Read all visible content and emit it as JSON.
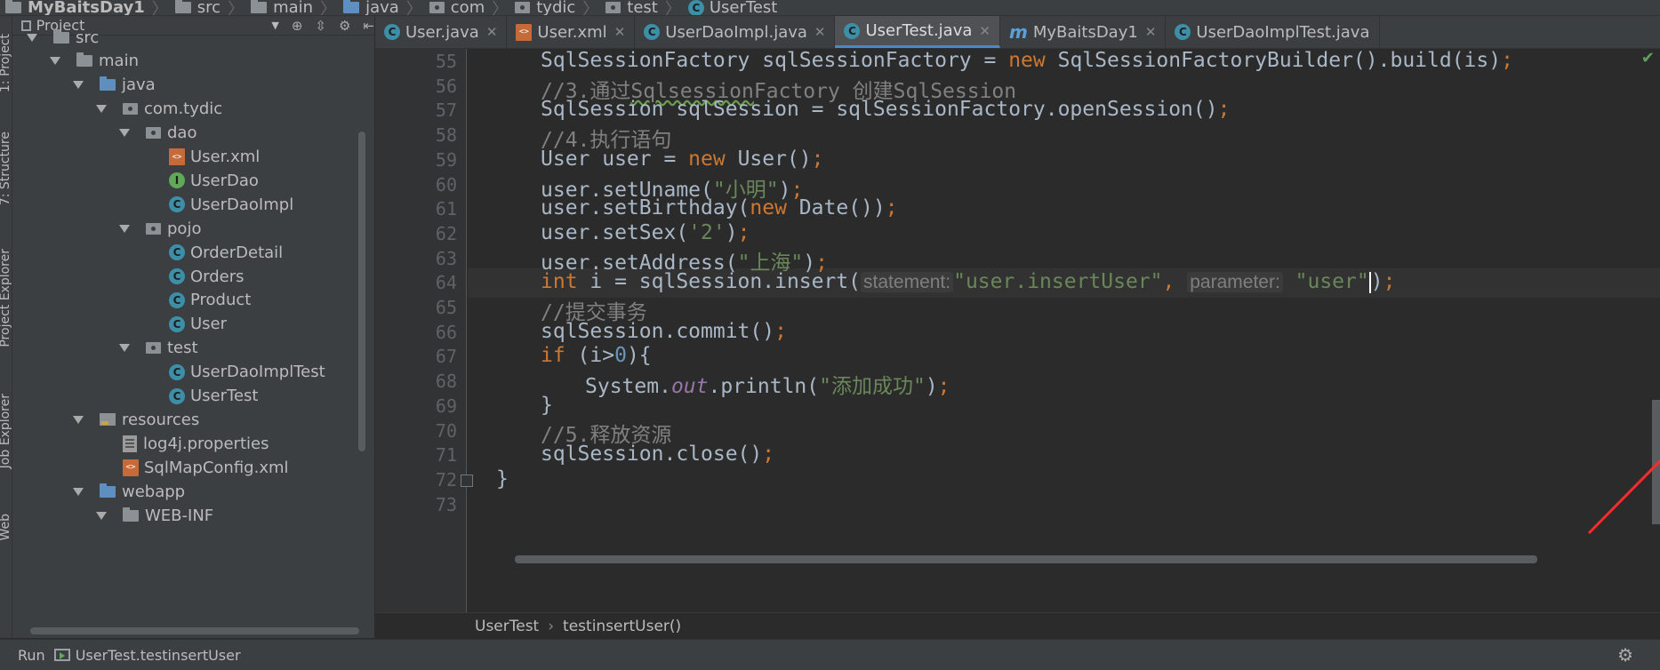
{
  "breadcrumb": {
    "items": [
      "MyBaitsDay1",
      "src",
      "main",
      "java",
      "com",
      "tydic",
      "test",
      "UserTest"
    ]
  },
  "side_tabs": {
    "project": "1: Project",
    "structure": "7: Structure",
    "project_explorer": "Project Explorer",
    "job_explorer": "Job Explorer",
    "web": "Web"
  },
  "project_panel": {
    "title": "Project",
    "tree": [
      {
        "label": "src",
        "type": "folder",
        "depth": 0,
        "expanded": true
      },
      {
        "label": "main",
        "type": "folder",
        "depth": 1,
        "expanded": true
      },
      {
        "label": "java",
        "type": "folder-blue",
        "depth": 2,
        "expanded": true
      },
      {
        "label": "com.tydic",
        "type": "package",
        "depth": 3,
        "expanded": true
      },
      {
        "label": "dao",
        "type": "package",
        "depth": 4,
        "expanded": true
      },
      {
        "label": "User.xml",
        "type": "xml",
        "depth": 5
      },
      {
        "label": "UserDao",
        "type": "interface",
        "depth": 5
      },
      {
        "label": "UserDaoImpl",
        "type": "class",
        "depth": 5
      },
      {
        "label": "pojo",
        "type": "package",
        "depth": 4,
        "expanded": true
      },
      {
        "label": "OrderDetail",
        "type": "class",
        "depth": 5
      },
      {
        "label": "Orders",
        "type": "class",
        "depth": 5
      },
      {
        "label": "Product",
        "type": "class",
        "depth": 5
      },
      {
        "label": "User",
        "type": "class",
        "depth": 5
      },
      {
        "label": "test",
        "type": "package",
        "depth": 4,
        "expanded": true
      },
      {
        "label": "UserDaoImplTest",
        "type": "class",
        "depth": 5
      },
      {
        "label": "UserTest",
        "type": "class",
        "depth": 5
      },
      {
        "label": "resources",
        "type": "resources",
        "depth": 2,
        "expanded": true
      },
      {
        "label": "log4j.properties",
        "type": "properties",
        "depth": 3
      },
      {
        "label": "SqlMapConfig.xml",
        "type": "xml",
        "depth": 3
      },
      {
        "label": "webapp",
        "type": "folder-blue",
        "depth": 2,
        "expanded": true
      },
      {
        "label": "WEB-INF",
        "type": "folder",
        "depth": 3,
        "expanded": true
      }
    ]
  },
  "tabs": [
    {
      "label": "User.java",
      "icon": "class-icon",
      "active": false
    },
    {
      "label": "User.xml",
      "icon": "xml-file-icon",
      "active": false
    },
    {
      "label": "UserDaoImpl.java",
      "icon": "class-icon",
      "active": false
    },
    {
      "label": "UserTest.java",
      "icon": "class-icon",
      "active": true
    },
    {
      "label": "MyBaitsDay1",
      "icon": "maven-icon",
      "active": false
    },
    {
      "label": "UserDaoImplTest.java",
      "icon": "class-icon",
      "active": false
    }
  ],
  "editor": {
    "line_numbers": [
      "55",
      "56",
      "57",
      "58",
      "59",
      "60",
      "61",
      "62",
      "63",
      "64",
      "65",
      "66",
      "67",
      "68",
      "69",
      "70",
      "71",
      "72",
      "73"
    ],
    "l55": {
      "a": "SqlSessionFactory sqlSessionFactory = ",
      "kw": "new",
      "b": " SqlSessionFactoryBuilder().build(is)",
      "semi": ";"
    },
    "l56": {
      "a": "//3.通过",
      "b": "Sqlsession",
      "c": "Factory 创建SqlSession"
    },
    "l57": {
      "a": "SqlSession sqlSession = sqlSessionFactory.openSession()",
      "semi": ";"
    },
    "l58": {
      "a": "//4.执行语句"
    },
    "l59": {
      "a": "User user = ",
      "kw": "new",
      "b": " User()",
      "semi": ";"
    },
    "l60": {
      "a": "user.setUname(",
      "s": "\"小明\"",
      "b": ")",
      "semi": ";"
    },
    "l61": {
      "a": "user.setBirthday(",
      "kw": "new",
      "b": " Date())",
      "semi": ";"
    },
    "l62": {
      "a": "user.setSex(",
      "s": "'2'",
      "b": ")",
      "semi": ";"
    },
    "l63": {
      "a": "user.setAddress(",
      "s": "\"上海\"",
      "b": ")",
      "semi": ";"
    },
    "l64": {
      "kw": "int",
      "a": " i = sqlSession.insert(",
      "hint1": "statement:",
      "s1": "\"user.insertUser\"",
      "comma": ",",
      "hint2": "parameter:",
      "s2": "\"user\"",
      "b": ")",
      "semi": ";"
    },
    "l65": {
      "a": "//提交事务"
    },
    "l66": {
      "a": "sqlSession.commit()",
      "semi": ";"
    },
    "l67": {
      "kw": "if",
      "a": " (i>",
      "n": "0",
      "b": "){"
    },
    "l68": {
      "a": "System.",
      "f": "out",
      "b": ".println(",
      "s": "\"添加成功\"",
      "c": ")",
      "semi": ";"
    },
    "l69": {
      "a": "}"
    },
    "l70": {
      "a": "//5.释放资源"
    },
    "l71": {
      "a": "sqlSession.close()",
      "semi": ";"
    },
    "l72": {
      "a": "}"
    }
  },
  "editor_breadcrumb": {
    "class": "UserTest",
    "method": "testinsertUser()"
  },
  "run_bar": {
    "label": "Run",
    "config": "UserTest.testinsertUser"
  },
  "colors": {
    "accent": "#4a88c7",
    "annotation_arrow": "#ff2a2a",
    "keyword": "#cc7832",
    "string": "#6a8759",
    "comment": "#808080"
  }
}
